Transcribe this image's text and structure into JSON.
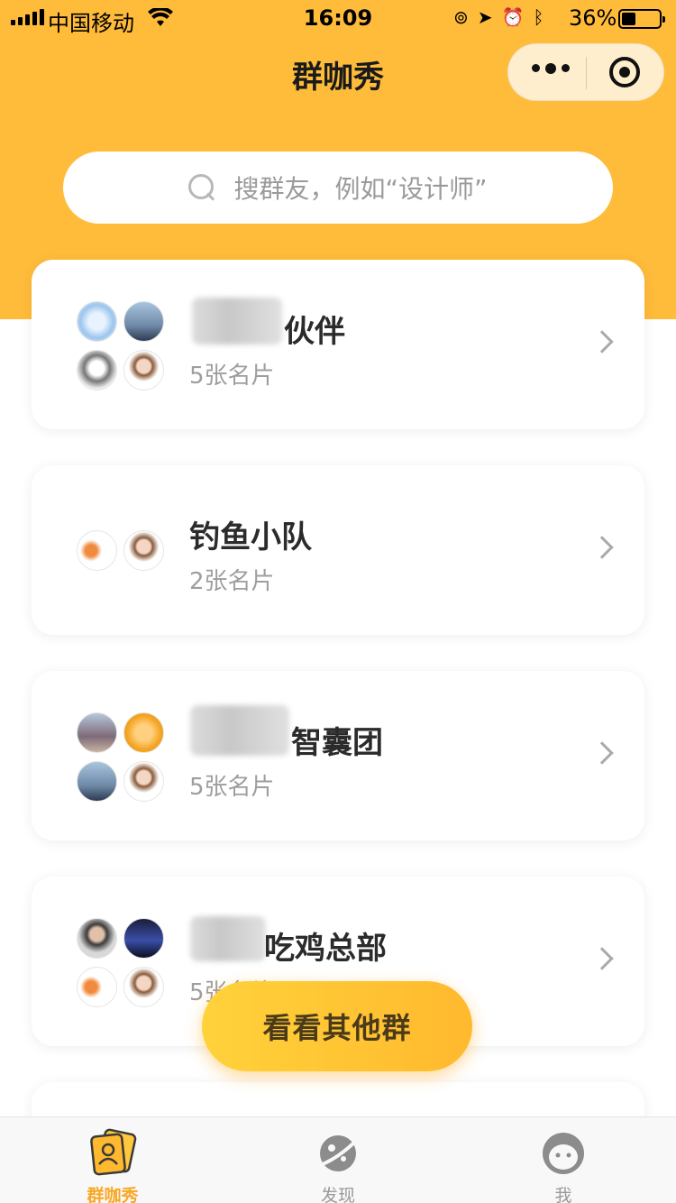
{
  "status_bar": {
    "carrier": "中国移动",
    "time": "16:09",
    "battery": "36%"
  },
  "nav": {
    "title": "群咖秀"
  },
  "search": {
    "placeholder": "搜群友，例如“设计师”"
  },
  "groups": [
    {
      "name": "伙伴",
      "count": "5张名片"
    },
    {
      "name": "钓鱼小队",
      "count": "2张名片"
    },
    {
      "name": "智囊团",
      "count": "5张名片"
    },
    {
      "name": "吃鸡总部",
      "count": "5张名片"
    }
  ],
  "fab": {
    "label": "看看其他群"
  },
  "tabbar": {
    "tabs": [
      {
        "label": "群咖秀",
        "active": true
      },
      {
        "label": "发现",
        "active": false
      },
      {
        "label": "我",
        "active": false
      }
    ],
    "accent": "#F7A824"
  },
  "colors": {
    "header": "#FFBB3A",
    "accent": "#FFB92E"
  }
}
